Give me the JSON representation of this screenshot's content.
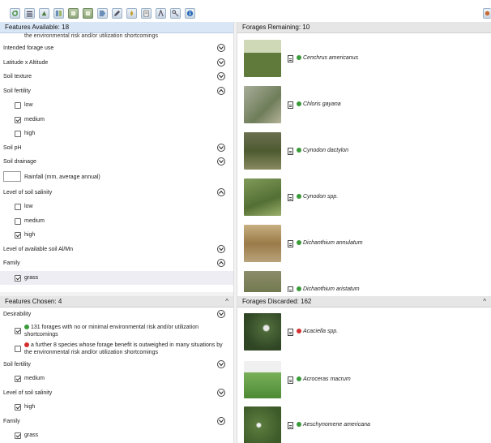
{
  "features_available": {
    "header": "Features Available: 18",
    "cut_top": "the environmental risk and/or utilization shortcomings",
    "rows": [
      {
        "label": "Intended forage use"
      },
      {
        "label": "Latitude x Altitude"
      },
      {
        "label": "Soil texture"
      },
      {
        "label": "Soil fertility"
      },
      {
        "label": "low"
      },
      {
        "label": "medium"
      },
      {
        "label": "high"
      },
      {
        "label": "Soil pH"
      },
      {
        "label": "Soil drainage"
      },
      {
        "label": "Rainfall (mm, average annual)"
      },
      {
        "label": "Level of soil salinity"
      },
      {
        "label": "low"
      },
      {
        "label": "medium"
      },
      {
        "label": "high"
      },
      {
        "label": "Level of available soil Al/Mn"
      },
      {
        "label": "Family"
      },
      {
        "label": "grass"
      }
    ]
  },
  "features_chosen": {
    "header": "Features Chosen: 4",
    "collapse": "^",
    "rows": [
      {
        "label": "Desirability"
      },
      {
        "label_line1": "131 forages with no or minimal environmental risk and/or utilization",
        "label_line2": "shortcomings"
      },
      {
        "label_line1": "a further 8 species whose forage benefit is outweighed in many situations by",
        "label_line2": "the environmental risk and/or utilization shortcomings"
      },
      {
        "label": "Soil fertility"
      },
      {
        "label": "medium"
      },
      {
        "label": "Level of soil salinity"
      },
      {
        "label": "high"
      },
      {
        "label": "Family"
      },
      {
        "label": "grass"
      }
    ]
  },
  "forages_remaining": {
    "header": "Forages Remaining: 10",
    "items": [
      {
        "name": "Cenchrus americanus",
        "status": "green"
      },
      {
        "name": "Chloris gayana",
        "status": "green"
      },
      {
        "name": "Cynodon dactylon",
        "status": "green"
      },
      {
        "name": "Cynodon spp.",
        "status": "green"
      },
      {
        "name": "Dichanthium annulatum",
        "status": "green"
      },
      {
        "name": "Dichanthium aristatum",
        "status": "green"
      }
    ]
  },
  "forages_discarded": {
    "header": "Forages Discarded: 162",
    "collapse": "^",
    "items": [
      {
        "name": "Acaciella spp.",
        "status": "red"
      },
      {
        "name": "Acroceras macrum",
        "status": "green"
      },
      {
        "name": "Aeschynomene americana",
        "status": "green"
      }
    ]
  },
  "colors": {
    "header_blue": "#d9e6f6",
    "header_grey": "#e6e6e6",
    "status_green": "#3a9b3a",
    "status_red": "#d23030"
  }
}
